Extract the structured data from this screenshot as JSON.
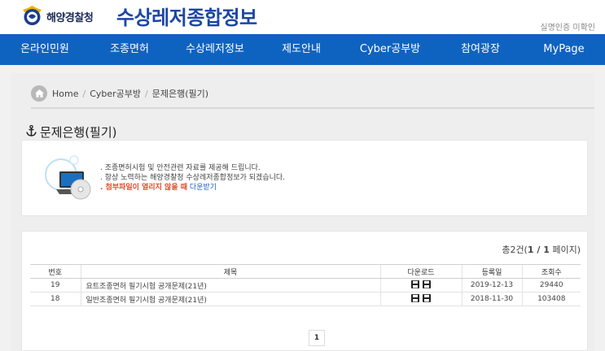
{
  "header": {
    "org_name": "해양경찰청",
    "site_title": "수상레저종합정보",
    "auth_status": "실명인증 미확인"
  },
  "nav": {
    "items": [
      "온라인민원",
      "조종면허",
      "수상레저정보",
      "제도안내",
      "Cyber공부방",
      "참여광장",
      "MyPage"
    ]
  },
  "breadcrumb": {
    "items": [
      "Home",
      "Cyber공부방",
      "문제은행(필기)"
    ],
    "separator": "/"
  },
  "page": {
    "title": "문제은행(필기)"
  },
  "info": {
    "line1": ". 조종면허시험 및 안전관련 자료를 제공해 드립니다.",
    "line2": ". 항상 노력하는 해양경찰청 수상레저종합정보가 되겠습니다.",
    "line3_prefix": ". 첨부파일이 열리지 않을 때",
    "line3_link": "다운받기"
  },
  "list": {
    "total_prefix": "총",
    "total_count": "2",
    "total_suffix": "건(",
    "page_info": "1 / 1",
    "page_suffix": " 페이지)",
    "columns": [
      "번호",
      "제목",
      "다운로드",
      "등록일",
      "조회수"
    ],
    "rows": [
      {
        "no": "19",
        "title": "요트조종면허 필기시험 공개문제(21년)",
        "date": "2019-12-13",
        "views": "29440"
      },
      {
        "no": "18",
        "title": "일반조종면허 필기시험 공개문제(21년)",
        "date": "2018-11-30",
        "views": "103408"
      }
    ],
    "current_page": "1"
  },
  "colors": {
    "nav_bg": "#0f63c0",
    "title_blue": "#1c46a5",
    "warn_red": "#e14b2b"
  }
}
